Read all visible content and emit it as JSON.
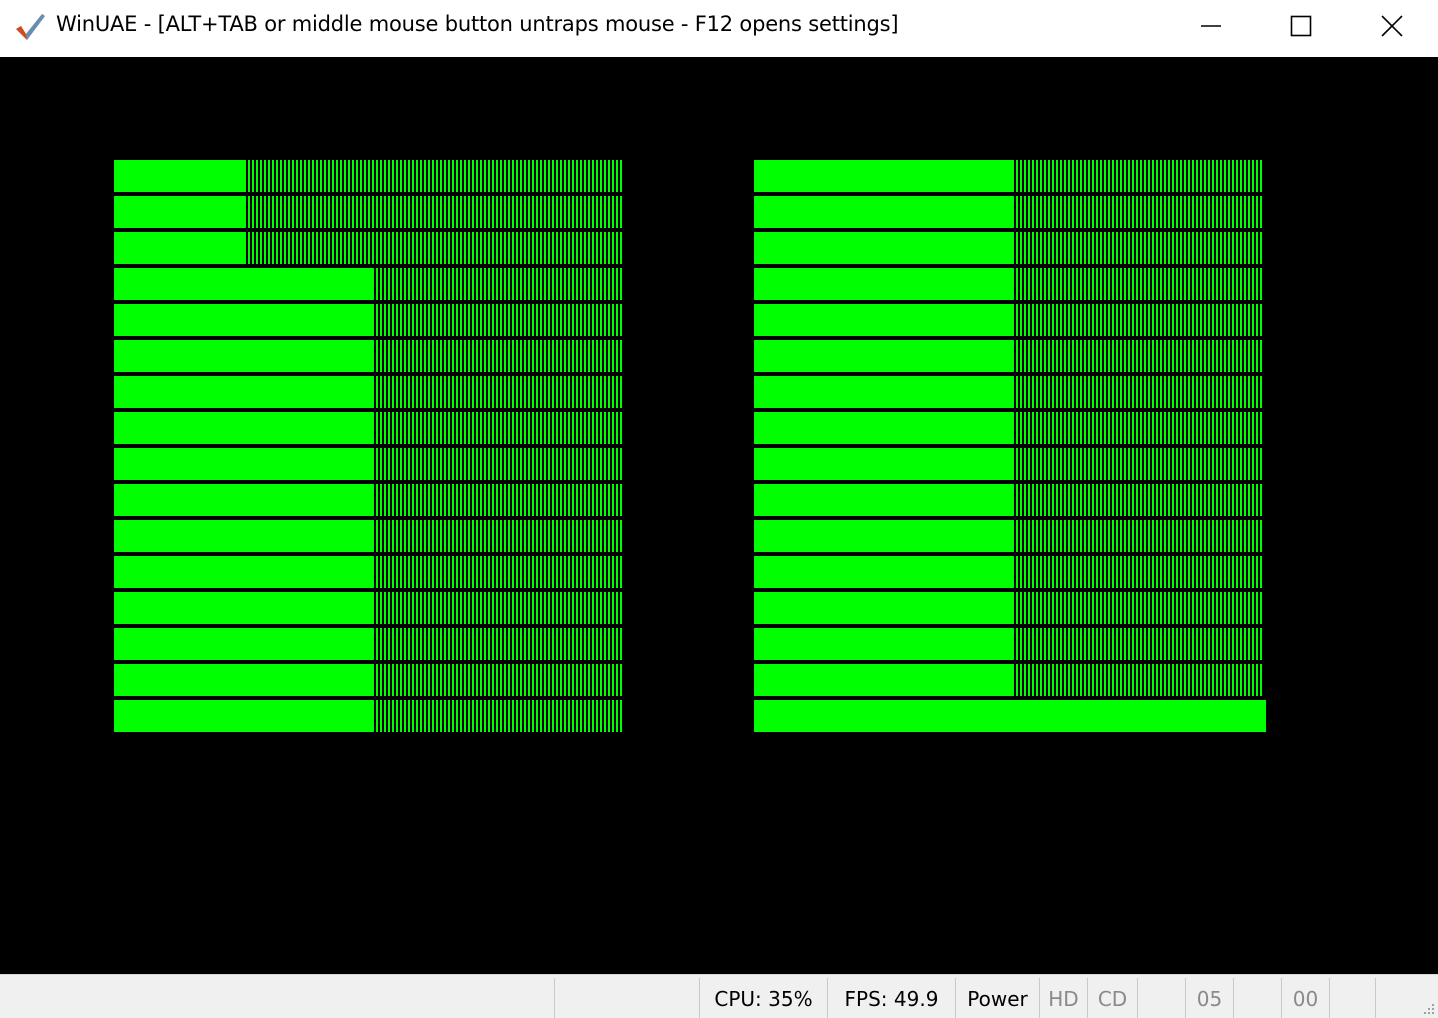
{
  "window": {
    "title": "WinUAE - [ALT+TAB or middle mouse button untraps mouse - F12 opens settings]",
    "app_icon": "winuae-checkmark-icon",
    "controls": {
      "minimize_icon": "minimize-icon",
      "maximize_icon": "maximize-icon",
      "close_icon": "close-icon"
    }
  },
  "display": {
    "background_color": "#000000",
    "pattern_color": "#00ff00"
  },
  "statusbar": {
    "cpu": "CPU: 35%",
    "fps": "FPS: 49.9",
    "power": "Power",
    "hd": "HD",
    "cd": "CD",
    "drive1": "05",
    "drive2": "00"
  }
}
